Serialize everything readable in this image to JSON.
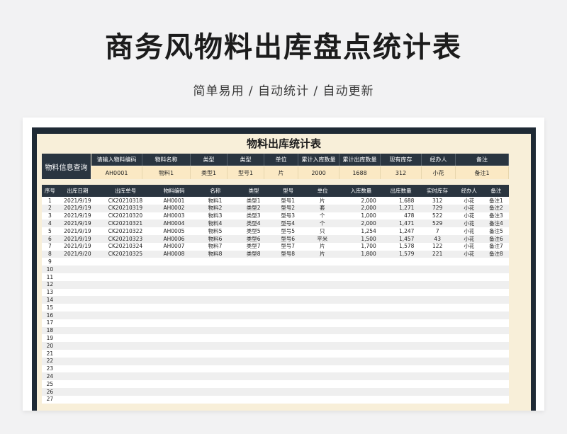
{
  "page": {
    "title": "商务风物料出库盘点统计表",
    "subtitle": "简单易用 / 自动统计 / 自动更新"
  },
  "sheet": {
    "title": "物料出库统计表",
    "lookup": {
      "label": "物料信息查询",
      "headers": [
        "请输入物料编码",
        "物料名称",
        "类型",
        "类型",
        "单位",
        "累计入库数量",
        "累计出库数量",
        "现有库存",
        "经办人",
        "备注"
      ],
      "values": [
        "AH0001",
        "物料1",
        "类型1",
        "型号1",
        "片",
        "2000",
        "1688",
        "312",
        "小花",
        "备注1"
      ]
    },
    "table": {
      "columns": [
        "序号",
        "出库日期",
        "出库单号",
        "物料编码",
        "名称",
        "类型",
        "型号",
        "单位",
        "入库数量",
        "出库数量",
        "实时库存",
        "经办人",
        "备注"
      ],
      "rows": [
        [
          "1",
          "2021/9/19",
          "CK20210318",
          "AH0001",
          "物料1",
          "类型1",
          "型号1",
          "片",
          "2,000",
          "1,688",
          "312",
          "小花",
          "备注1"
        ],
        [
          "2",
          "2021/9/19",
          "CK20210319",
          "AH0002",
          "物料2",
          "类型2",
          "型号2",
          "套",
          "2,000",
          "1,271",
          "729",
          "小花",
          "备注2"
        ],
        [
          "3",
          "2021/9/19",
          "CK20210320",
          "AH0003",
          "物料3",
          "类型3",
          "型号3",
          "个",
          "1,000",
          "478",
          "522",
          "小花",
          "备注3"
        ],
        [
          "4",
          "2021/9/19",
          "CK20210321",
          "AH0004",
          "物料4",
          "类型4",
          "型号4",
          "个",
          "2,000",
          "1,471",
          "529",
          "小花",
          "备注4"
        ],
        [
          "5",
          "2021/9/19",
          "CK20210322",
          "AH0005",
          "物料5",
          "类型5",
          "型号5",
          "只",
          "1,254",
          "1,247",
          "7",
          "小花",
          "备注5"
        ],
        [
          "6",
          "2021/9/19",
          "CK20210323",
          "AH0006",
          "物料6",
          "类型6",
          "型号6",
          "平米",
          "1,500",
          "1,457",
          "43",
          "小花",
          "备注6"
        ],
        [
          "7",
          "2021/9/19",
          "CK20210324",
          "AH0007",
          "物料7",
          "类型7",
          "型号7",
          "片",
          "1,700",
          "1,578",
          "122",
          "小花",
          "备注7"
        ],
        [
          "8",
          "2021/9/20",
          "CK20210325",
          "AH0008",
          "物料8",
          "类型8",
          "型号8",
          "片",
          "1,800",
          "1,579",
          "221",
          "小花",
          "备注8"
        ],
        [
          "9"
        ],
        [
          "10"
        ],
        [
          "11"
        ],
        [
          "12"
        ],
        [
          "13"
        ],
        [
          "14"
        ],
        [
          "15"
        ],
        [
          "16"
        ],
        [
          "17"
        ],
        [
          "18"
        ],
        [
          "19"
        ],
        [
          "20"
        ],
        [
          "21"
        ],
        [
          "22"
        ],
        [
          "23"
        ],
        [
          "24"
        ],
        [
          "25"
        ],
        [
          "26"
        ],
        [
          "27"
        ]
      ]
    }
  },
  "colors": {
    "header_bg": "#2a3540",
    "frame_bg": "#1f2a35",
    "cream_bg": "#f8efd9",
    "lookup_value_bg": "#fbe9c4"
  }
}
